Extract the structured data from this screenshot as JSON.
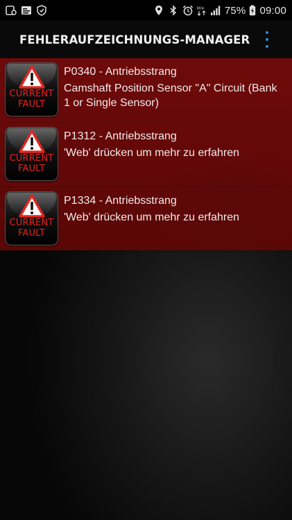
{
  "status_bar": {
    "left_icons": [
      "notification-app-icon",
      "gallery-icon",
      "shield-icon"
    ],
    "right_icons": [
      "location-icon",
      "bluetooth-icon",
      "alarm-icon",
      "mobile-data-icon",
      "signal-icon"
    ],
    "network_label": "H+",
    "battery_percent": "75%",
    "time": "09:00"
  },
  "app_bar": {
    "title": "FEHLERAUFZEICHNUNGS-MANAGER",
    "menu_icon": "overflow-menu-icon",
    "accent_color": "#2a8fd8"
  },
  "faults": [
    {
      "badge_line1": "CURRENT",
      "badge_line2": "FAULT",
      "code": "P0340 - Antriebsstrang",
      "description": "Camshaft Position Sensor \"A\" Circuit (Bank 1 or Single Sensor)"
    },
    {
      "badge_line1": "CURRENT",
      "badge_line2": "FAULT",
      "code": "P1312 - Antriebsstrang",
      "description": "'Web' drücken um mehr zu erfahren"
    },
    {
      "badge_line1": "CURRENT",
      "badge_line2": "FAULT",
      "code": "P1334 - Antriebsstrang",
      "description": "'Web' drücken um mehr zu erfahren"
    }
  ],
  "colors": {
    "list_background": "#6e0a0a",
    "badge_text": "#e82020",
    "warning_triangle": "#e0261f"
  }
}
